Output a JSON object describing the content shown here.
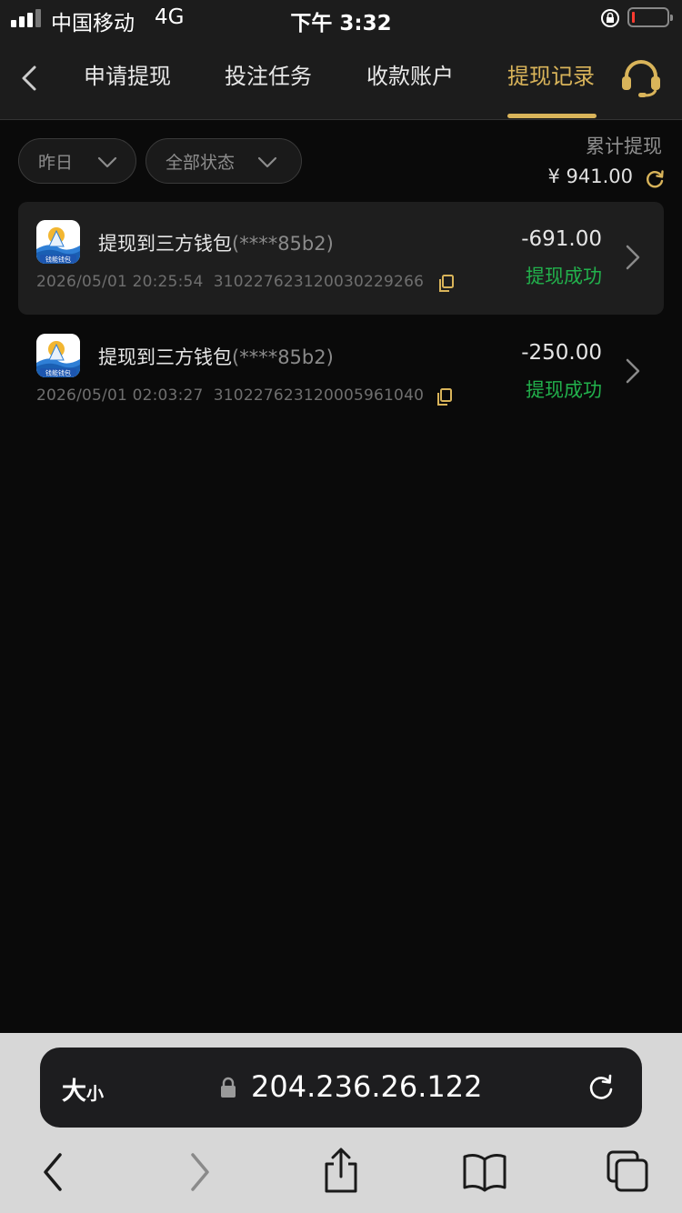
{
  "status_bar": {
    "carrier": "中国移动",
    "network": "4G",
    "time": "下午 3:32"
  },
  "tabs": [
    {
      "label": "申请提现",
      "active": false
    },
    {
      "label": "投注任务",
      "active": false
    },
    {
      "label": "收款账户",
      "active": false
    },
    {
      "label": "提现记录",
      "active": true
    }
  ],
  "filters": {
    "date": "昨日",
    "status": "全部状态"
  },
  "summary": {
    "label": "累计提现",
    "value": "¥ 941.00"
  },
  "records": [
    {
      "title": "提现到三方钱包",
      "account_mask": "(****85b2)",
      "datetime": "2026/05/01 20:25:54",
      "order_no": "310227623120030229266",
      "amount": "-691.00",
      "status": "提现成功"
    },
    {
      "title": "提现到三方钱包",
      "account_mask": "(****85b2)",
      "datetime": "2026/05/01 02:03:27",
      "order_no": "310227623120005961040",
      "amount": "-250.00",
      "status": "提现成功"
    }
  ],
  "wallet_icon_text": "钱能钱包",
  "browser": {
    "text_size_big": "大",
    "text_size_small": "小",
    "url": "204.236.26.122"
  },
  "colors": {
    "accent": "#d9b45a",
    "success": "#22b14c",
    "background": "#0a0a0a"
  }
}
